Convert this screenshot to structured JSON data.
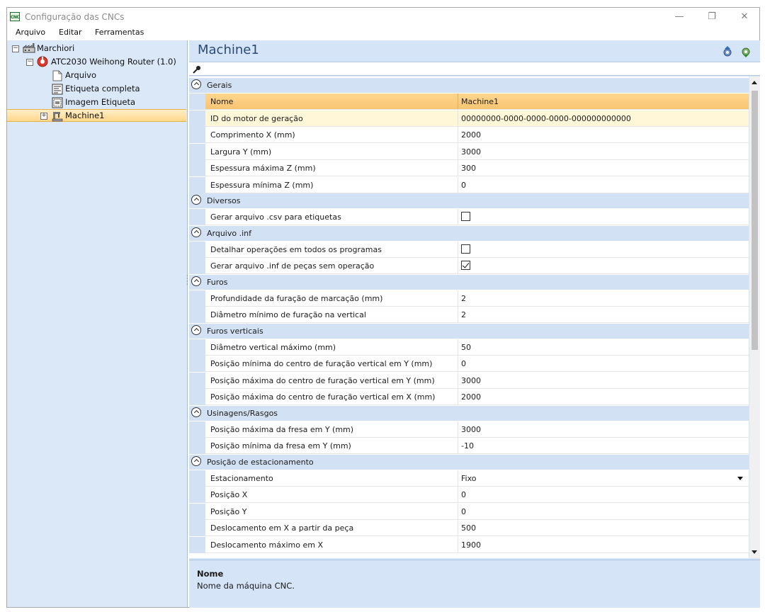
{
  "window": {
    "title": "Configuração das CNCs",
    "app_icon_text": "CNC"
  },
  "menu": [
    "Arquivo",
    "Editar",
    "Ferramentas"
  ],
  "tree": {
    "root": "Marchiori",
    "router": "ATC2030 Weihong Router (1.0)",
    "children": [
      "Arquivo",
      "Etiqueta completa",
      "Imagem Etiqueta"
    ],
    "selected": "Machine1"
  },
  "panel": {
    "title": "Machine1"
  },
  "grid": {
    "categories": [
      {
        "label": "Gerais",
        "props": [
          {
            "name": "Nome",
            "value": "Machine1"
          },
          {
            "name": "ID do motor de geração",
            "value": "00000000-0000-0000-0000-000000000000"
          },
          {
            "name": "Comprimento X (mm)",
            "value": "2000"
          },
          {
            "name": "Largura Y (mm)",
            "value": "3000"
          },
          {
            "name": "Espessura máxima Z (mm)",
            "value": "300"
          },
          {
            "name": "Espessura mínima Z (mm)",
            "value": "0"
          }
        ]
      },
      {
        "label": "Diversos",
        "props": [
          {
            "name": "Gerar arquivo .csv para etiquetas",
            "checked": false
          }
        ]
      },
      {
        "label": "Arquivo .inf",
        "props": [
          {
            "name": "Detalhar operações em todos os programas",
            "checked": false
          },
          {
            "name": "Gerar arquivo .inf de peças sem operação",
            "checked": true
          }
        ]
      },
      {
        "label": "Furos",
        "props": [
          {
            "name": "Profundidade da furação de marcação (mm)",
            "value": "2"
          },
          {
            "name": "Diâmetro mínimo de furação na vertical",
            "value": "2"
          }
        ]
      },
      {
        "label": "Furos verticais",
        "props": [
          {
            "name": "Diâmetro vertical máximo (mm)",
            "value": "50"
          },
          {
            "name": "Posição mínima do centro de furação vertical em Y (mm)",
            "value": "0"
          },
          {
            "name": "Posição máxima do centro de furação vertical em Y (mm)",
            "value": "3000"
          },
          {
            "name": "Posição máxima do centro de furação vertical em X (mm)",
            "value": "2000"
          }
        ]
      },
      {
        "label": "Usinagens/Rasgos",
        "props": [
          {
            "name": "Posição máxima da fresa em Y (mm)",
            "value": "3000"
          },
          {
            "name": "Posição mínima da fresa em Y (mm)",
            "value": "-10"
          }
        ]
      },
      {
        "label": "Posição de estacionamento",
        "props": [
          {
            "name": "Estacionamento",
            "value": "Fixo",
            "dropdown": true
          },
          {
            "name": "Posição X",
            "value": "0"
          },
          {
            "name": "Posição Y",
            "value": "0"
          },
          {
            "name": "Deslocamento em X a partir da peça",
            "value": "500"
          },
          {
            "name": "Deslocamento máximo em X",
            "value": "1900"
          }
        ]
      }
    ]
  },
  "help": {
    "title": "Nome",
    "description": "Nome da máquina CNC."
  }
}
